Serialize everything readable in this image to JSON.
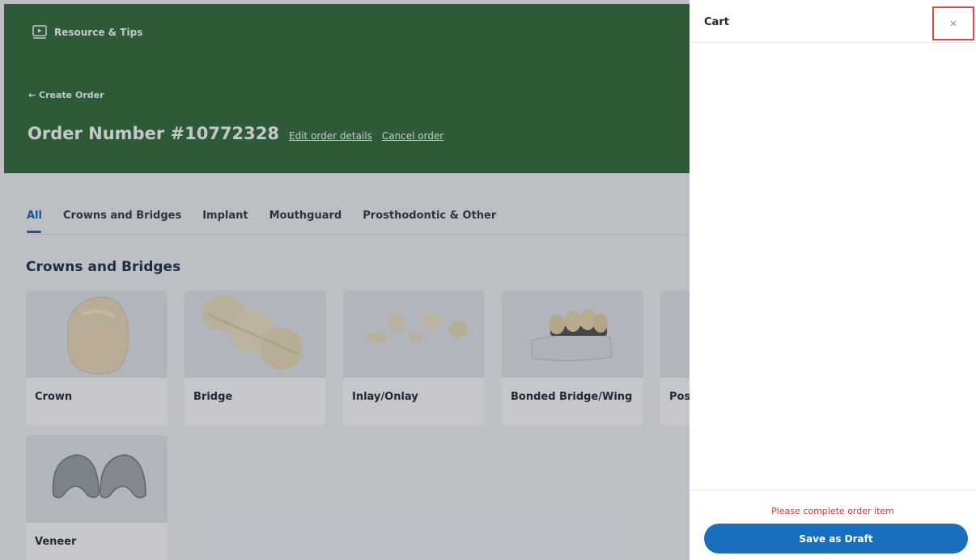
{
  "header": {
    "resource_label": "Resource & Tips",
    "back_label": "← Create Order",
    "order_title": "Order Number #10772328",
    "edit_link": "Edit order details",
    "cancel_link": "Cancel order"
  },
  "tabs": [
    {
      "label": "All",
      "active": true
    },
    {
      "label": "Crowns and Bridges",
      "active": false
    },
    {
      "label": "Implant",
      "active": false
    },
    {
      "label": "Mouthguard",
      "active": false
    },
    {
      "label": "Prosthodontic & Other",
      "active": false
    }
  ],
  "section_title": "Crowns and Bridges",
  "products": [
    {
      "label": "Crown"
    },
    {
      "label": "Bridge"
    },
    {
      "label": "Inlay/Onlay"
    },
    {
      "label": "Bonded Bridge/Wing"
    },
    {
      "label": "Pos"
    },
    {
      "label": "Veneer"
    }
  ],
  "cart": {
    "title": "Cart",
    "close_glyph": "×",
    "error_message": "Please complete order item",
    "save_label": "Save as Draft"
  },
  "colors": {
    "header_green": "#2d6a34",
    "accent_blue": "#1a6fbd",
    "error_red": "#e0352b"
  }
}
